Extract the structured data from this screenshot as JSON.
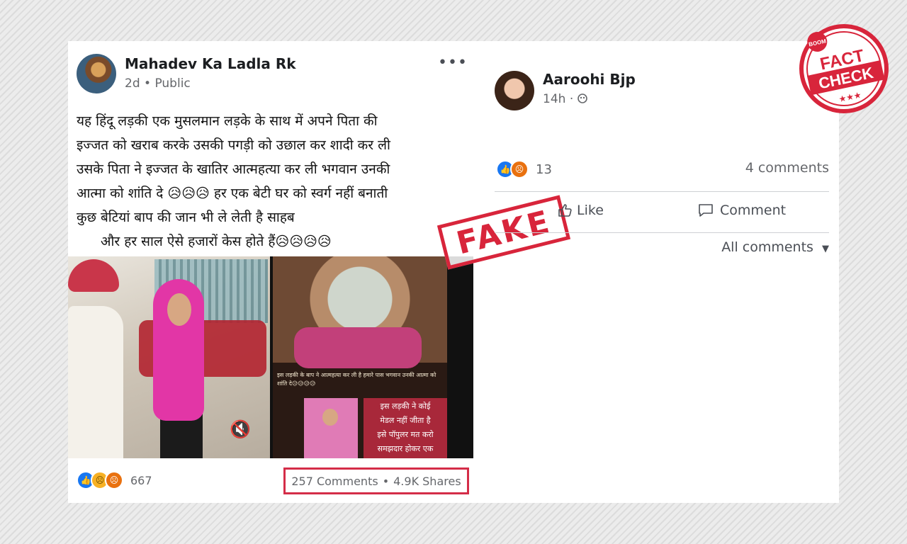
{
  "left_post": {
    "author": "Mahadev Ka Ladla Rk",
    "time": "2d",
    "separator": "•",
    "audience": "Public",
    "more_label": "•••",
    "text_lines": [
      "यह हिंदू लड़की एक मुसलमान लड़के के साथ में अपने  पिता की",
      "इज्जत को खराब करके उसकी पगड़ी को उछाल कर शादी कर ली",
      "उसके  पिता ने इज्जत के खातिर आत्महत्या कर ली भगवान उनकी",
      "आत्मा को शांति दे 😥😥😥 हर एक बेटी घर  को स्वर्ग नहीं बनाती",
      "कुछ बेटियां बाप की जान भी ले लेती है साहब",
      "और हर साल ऐसे हजारों केस होते हैं😥😥😥😥"
    ],
    "video_caption": "इस लड़की के बाप ने आत्महत्या कर ली है हमारे पास भगवान उनकी आत्मा को शांति दे😥😥😥😥",
    "overlay_lines": [
      "इस लड़की ने कोई",
      "मेडल नहीं जीता है",
      "इसे पॉपुलर मत करो",
      "समझदार होकर एक"
    ],
    "reaction_count": "667",
    "comments": "257 Comments",
    "stats_separator": "•",
    "shares": "4.9K Shares"
  },
  "stamp": {
    "text": "FAKE"
  },
  "right_post": {
    "author": "Aaroohi Bjp",
    "time": "14h",
    "separator": "·",
    "privacy_icon": "friends-icon",
    "reaction_count": "13",
    "comments_count": "4 comments",
    "like_label": "Like",
    "comment_label": "Comment",
    "all_comments_label": "All comments"
  },
  "logo": {
    "top": "BOOM",
    "line1": "FACT",
    "line2": "CHECK",
    "stars": "★★★"
  },
  "colors": {
    "stamp_red": "#d8253b",
    "fb_blue": "#1877f2",
    "meta_grey": "#65676b"
  }
}
